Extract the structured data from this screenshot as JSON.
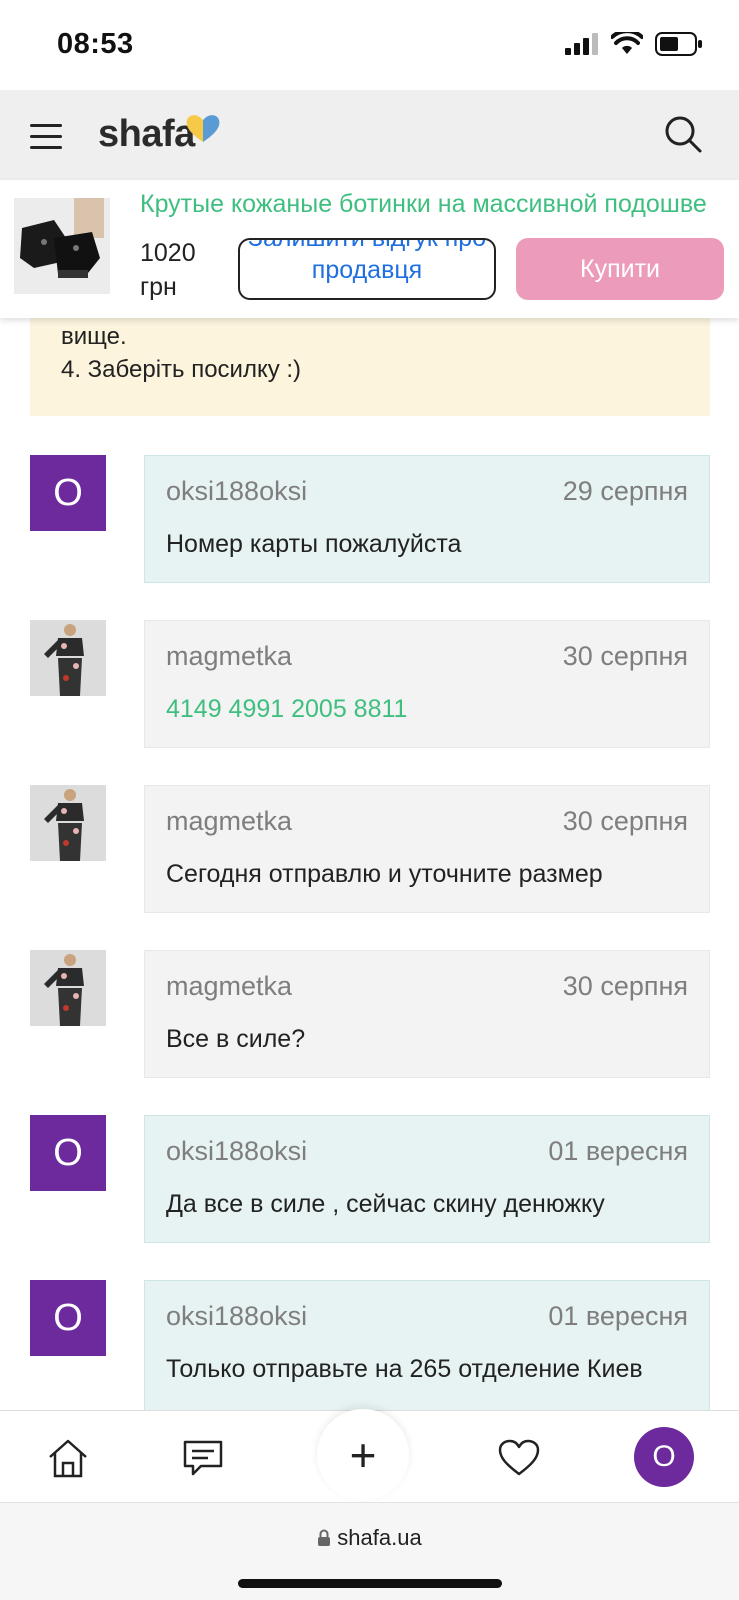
{
  "status_bar": {
    "time": "08:53"
  },
  "header": {
    "logo": "shafa"
  },
  "product": {
    "title": "Крутые кожаные ботинки на массивной подошве",
    "price_value": "1020",
    "price_currency": "грн",
    "review_button": "Залишити відгук про продавця",
    "buy_button": "Купити"
  },
  "info": {
    "lines": [
      "вище.",
      "4. Заберіть посилку :)"
    ]
  },
  "messages": [
    {
      "author": "oksi188oksi",
      "date": "29 серпня",
      "text": "Номер карты пожалуйста",
      "avatar": "О"
    },
    {
      "author": "magmetka",
      "date": "30 серпня",
      "text": "4149 4991 2005 8811",
      "avatar": ""
    },
    {
      "author": "magmetka",
      "date": "30 серпня",
      "text": "Сегодня отправлю и уточните размер",
      "avatar": ""
    },
    {
      "author": "magmetka",
      "date": "30 серпня",
      "text": "Все в силе?",
      "avatar": ""
    },
    {
      "author": "oksi188oksi",
      "date": "01 вересня",
      "text": "Да все в силе , сейчас скину денюжку",
      "avatar": "О"
    },
    {
      "author": "oksi188oksi",
      "date": "01 вересня",
      "text": "Только отправьте на 265 отделение Киев",
      "avatar": "О"
    }
  ],
  "bottom_nav": {
    "plus": "+",
    "avatar_letter": "О"
  },
  "browser": {
    "url": "shafa.ua"
  },
  "colors": {
    "accent_green": "#3fbf7f",
    "avatar_purple": "#6c2a9c",
    "buy_pink": "#ec9bbb",
    "link_blue": "#1f6fe0"
  }
}
